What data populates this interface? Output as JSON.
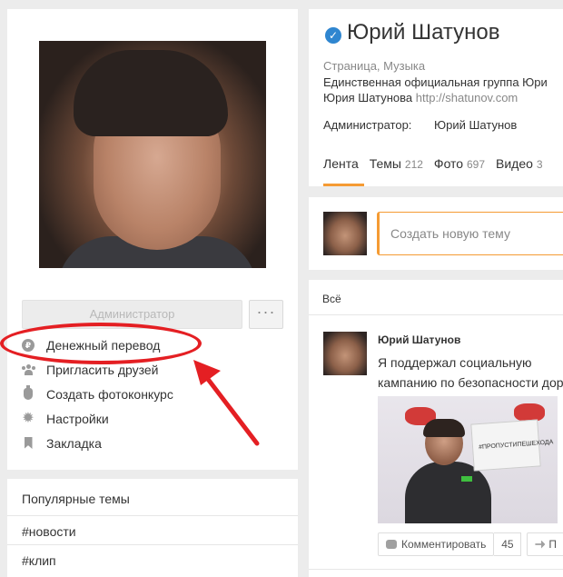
{
  "left": {
    "admin_button": "Администратор",
    "more_button": "···",
    "menu": [
      {
        "label": "Денежный перевод",
        "icon": "money-transfer-icon"
      },
      {
        "label": "Пригласить друзей",
        "icon": "invite-friends-icon"
      },
      {
        "label": "Создать фотоконкурс",
        "icon": "photo-contest-icon"
      },
      {
        "label": "Настройки",
        "icon": "settings-gear-icon"
      },
      {
        "label": "Закладка",
        "icon": "bookmark-icon"
      }
    ],
    "popular": {
      "title": "Популярные темы",
      "items": [
        "#новости",
        "#клип"
      ]
    }
  },
  "group": {
    "name": "Юрий Шатунов",
    "category": "Страница, Музыка",
    "description_line1": "Единственная официальная группа Юри",
    "description_line2": "Юрия Шатунова",
    "link": "http://shatunov.com",
    "admin_label": "Администратор:",
    "admin_name": "Юрий Шатунов",
    "tabs": [
      {
        "label": "Лента",
        "count": ""
      },
      {
        "label": "Темы",
        "count": "212"
      },
      {
        "label": "Фото",
        "count": "697"
      },
      {
        "label": "Видео",
        "count": "3"
      }
    ]
  },
  "new_topic": {
    "placeholder": "Создать новую тему"
  },
  "feed": {
    "tab": "Всё",
    "post": {
      "author": "Юрий Шатунов",
      "text_line1": "Я поддержал социальную",
      "text_line2": "кампанию по безопасности дор",
      "photo_sign_text": "#ПРОПУСТИПЕШЕХОДА",
      "comment_label": "Комментировать",
      "comment_count": "45",
      "share_label": "П"
    }
  },
  "colors": {
    "accent_orange": "#f59b33",
    "verified_blue": "#2f86d0",
    "annotation_red": "#e41f23",
    "background": "#ececec"
  }
}
